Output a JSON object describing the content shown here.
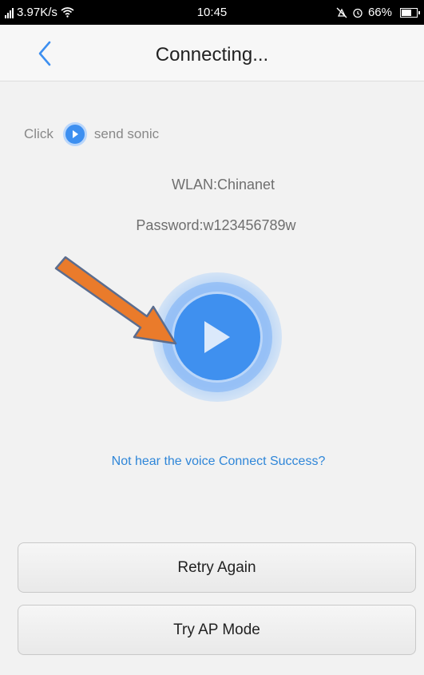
{
  "status_bar": {
    "network_speed": "3.97K/s",
    "time": "10:45",
    "battery": "66%"
  },
  "header": {
    "title": "Connecting..."
  },
  "hint": {
    "prefix": "Click",
    "suffix": "send sonic"
  },
  "wifi": {
    "wlan": "WLAN:Chinanet",
    "password": "Password:w123456789w"
  },
  "voice_link": "Not hear the voice Connect Success?",
  "buttons": {
    "retry": "Retry Again",
    "ap_mode": "Try AP Mode"
  },
  "colors": {
    "accent": "#3f90ef",
    "link": "#2f86d8",
    "arrow": "#e8792a"
  },
  "icons": {
    "back": "chevron-left-icon",
    "play": "play-icon",
    "annotation": "arrow-icon"
  }
}
